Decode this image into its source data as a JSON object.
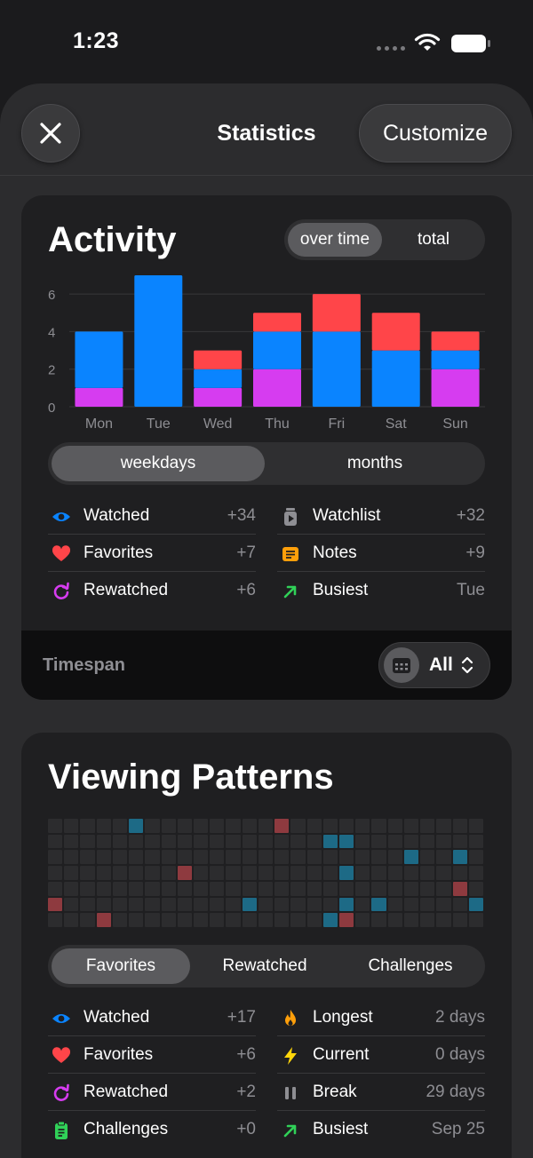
{
  "status": {
    "time": "1:23"
  },
  "nav": {
    "title": "Statistics",
    "customize_label": "Customize"
  },
  "activity": {
    "title": "Activity",
    "toggle": {
      "options": [
        "over time",
        "total"
      ],
      "selected": "over time"
    },
    "period": {
      "options": [
        "weekdays",
        "months"
      ],
      "selected": "weekdays"
    },
    "stats_left": [
      {
        "icon": "eye-icon",
        "label": "Watched",
        "value": "+34"
      },
      {
        "icon": "heart-icon",
        "label": "Favorites",
        "value": "+7"
      },
      {
        "icon": "rewatch-icon",
        "label": "Rewatched",
        "value": "+6"
      }
    ],
    "stats_right": [
      {
        "icon": "watchlist-icon",
        "label": "Watchlist",
        "value": "+32"
      },
      {
        "icon": "notes-icon",
        "label": "Notes",
        "value": "+9"
      },
      {
        "icon": "trend-arrow-icon",
        "label": "Busiest",
        "value": "Tue"
      }
    ],
    "timespan": {
      "label": "Timespan",
      "value": "All"
    }
  },
  "chart_data": {
    "type": "bar",
    "stacked": true,
    "categories": [
      "Mon",
      "Tue",
      "Wed",
      "Thu",
      "Fri",
      "Sat",
      "Sun"
    ],
    "series": [
      {
        "values": [
          1,
          0,
          1,
          2,
          0,
          0,
          2
        ],
        "color": "#d63cf0"
      },
      {
        "values": [
          3,
          7,
          1,
          2,
          4,
          3,
          1
        ],
        "color": "#0a84ff"
      },
      {
        "values": [
          0,
          0,
          1,
          1,
          2,
          2,
          1
        ],
        "color": "#ff4549"
      }
    ],
    "yticks": [
      0,
      2,
      4,
      6
    ],
    "ylim": [
      0,
      7
    ],
    "grid": true
  },
  "patterns": {
    "title": "Viewing Patterns",
    "tabs": {
      "options": [
        "Favorites",
        "Rewatched",
        "Challenges"
      ],
      "selected": "Favorites"
    },
    "grid": {
      "columns": 27,
      "rows": 7,
      "blue_cells": [
        [
          5,
          0
        ],
        [
          17,
          1
        ],
        [
          18,
          1
        ],
        [
          22,
          2
        ],
        [
          25,
          2
        ],
        [
          18,
          3
        ],
        [
          12,
          5
        ],
        [
          18,
          5
        ],
        [
          20,
          5
        ],
        [
          26,
          5
        ],
        [
          17,
          6
        ]
      ],
      "red_cells": [
        [
          14,
          0
        ],
        [
          8,
          3
        ],
        [
          25,
          4
        ],
        [
          0,
          5
        ],
        [
          3,
          6
        ],
        [
          18,
          6
        ]
      ]
    },
    "stats_left": [
      {
        "icon": "eye-icon",
        "label": "Watched",
        "value": "+17"
      },
      {
        "icon": "heart-icon",
        "label": "Favorites",
        "value": "+6"
      },
      {
        "icon": "rewatch-icon",
        "label": "Rewatched",
        "value": "+2"
      },
      {
        "icon": "clipboard-icon",
        "label": "Challenges",
        "value": "+0"
      }
    ],
    "stats_right": [
      {
        "icon": "flame-icon",
        "label": "Longest",
        "value": "2 days"
      },
      {
        "icon": "bolt-icon",
        "label": "Current",
        "value": "0 days"
      },
      {
        "icon": "pause-icon",
        "label": "Break",
        "value": "29 days"
      },
      {
        "icon": "trend-arrow-icon",
        "label": "Busiest",
        "value": "Sep 25"
      }
    ]
  },
  "colors": {
    "blue": "#0a84ff",
    "magenta": "#d63cf0",
    "red": "#ff4549",
    "green": "#30d158",
    "orange": "#ff9f0a",
    "yellow": "#ffd60a"
  }
}
